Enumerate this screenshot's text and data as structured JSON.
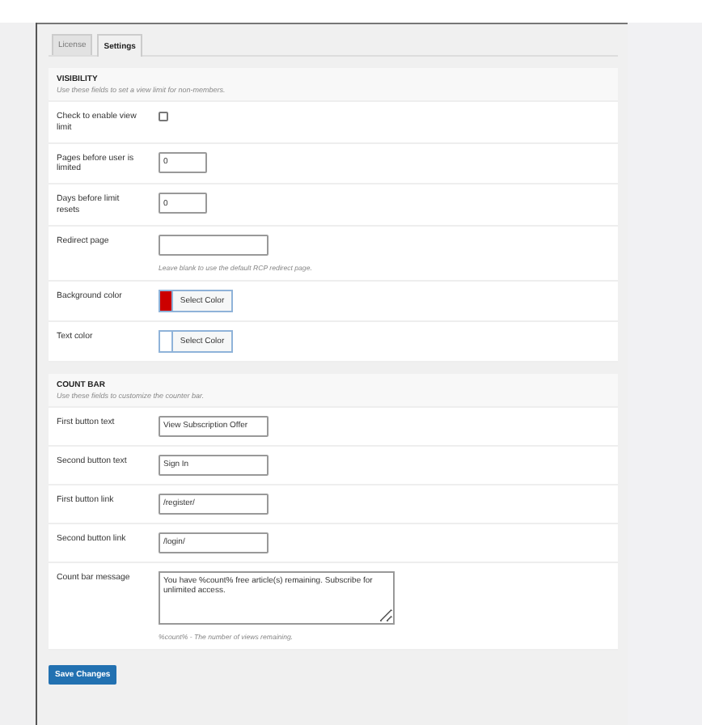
{
  "tabs": [
    {
      "label": "License",
      "selected": false
    },
    {
      "label": "Settings",
      "selected": true
    }
  ],
  "sections": [
    {
      "title": "VISIBILITY",
      "description": "Use these fields to set a view limit for non-members.",
      "rows": [
        {
          "kind": "checkbox",
          "label": "Check to enable view limit",
          "checked": false
        },
        {
          "kind": "number",
          "label": "Pages before user is limited",
          "value": "0"
        },
        {
          "kind": "number",
          "label": "Days before limit resets",
          "value": "0"
        },
        {
          "kind": "text",
          "label": "Redirect page",
          "value": "",
          "hint": "Leave blank to use the default RCP redirect page."
        },
        {
          "kind": "color",
          "label": "Background color",
          "button": "Select Color",
          "color": "#cc0000"
        },
        {
          "kind": "color",
          "label": "Text color",
          "button": "Select Color",
          "color": "#ffffff"
        }
      ]
    },
    {
      "title": "COUNT BAR",
      "description": "Use these fields to customize the counter bar.",
      "rows": [
        {
          "kind": "text",
          "label": "First button text",
          "value": "View Subscription Offer"
        },
        {
          "kind": "text",
          "label": "Second button text",
          "value": "Sign In"
        },
        {
          "kind": "text",
          "label": "First button link",
          "value": "/register/"
        },
        {
          "kind": "text",
          "label": "Second button link",
          "value": "/login/"
        },
        {
          "kind": "textarea",
          "label": "Count bar message",
          "value": "You have %count% free article(s) remaining. Subscribe for unlimited access.",
          "hint": "%count% - The number of views remaining."
        }
      ]
    }
  ],
  "save_button": "Save Changes"
}
